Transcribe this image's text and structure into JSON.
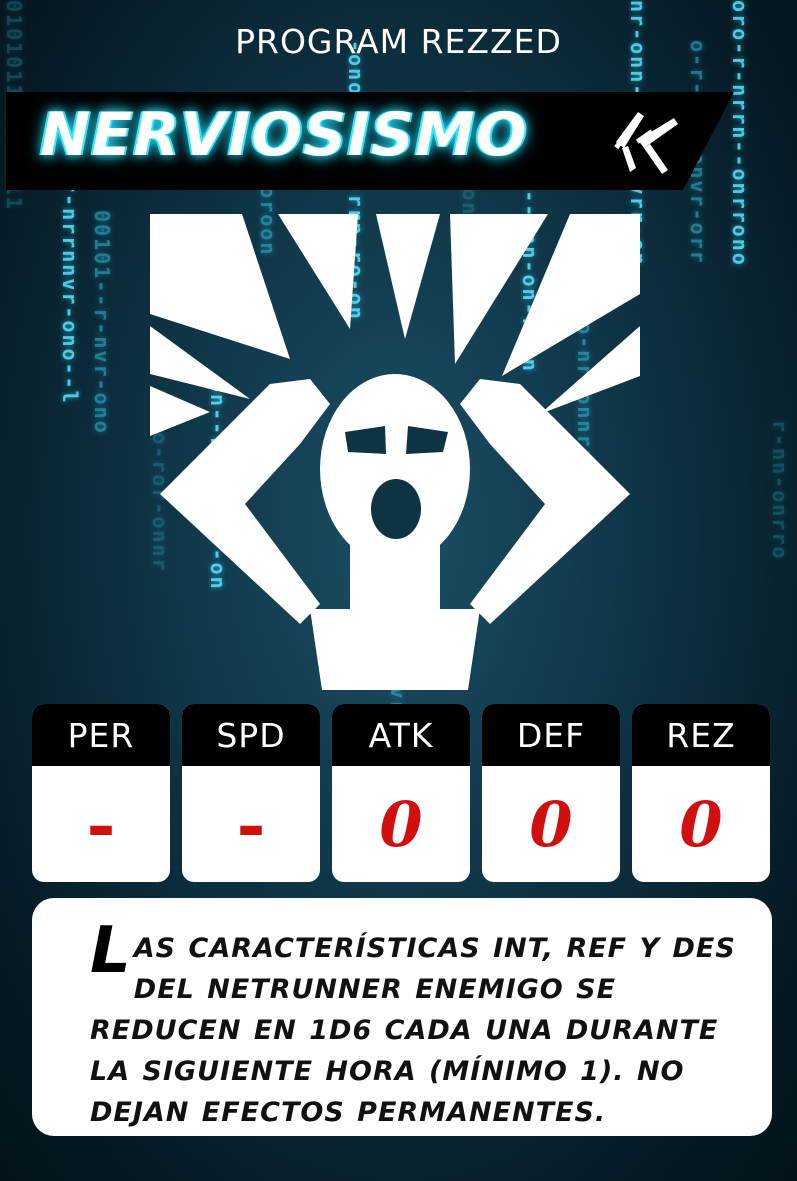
{
  "card": {
    "header": "PROGRAM REZZED",
    "title": "NERVIOSISMO",
    "type_icon": "crossed-knives-icon",
    "art_icon": "screaming-person-icon",
    "stats": [
      {
        "label": "PER",
        "value": "-"
      },
      {
        "label": "SPD",
        "value": "-"
      },
      {
        "label": "ATK",
        "value": "0"
      },
      {
        "label": "DEF",
        "value": "0"
      },
      {
        "label": "REZ",
        "value": "0"
      }
    ],
    "description_dropcap": "L",
    "description": "as características INT, REF y DES del netrunner enemigo se reducen en 1D6 cada una durante la siguiente hora (mínimo 1). No dejan efectos permanentes."
  },
  "colors": {
    "background": "#0e3345",
    "code_rain": "#3ad0ee",
    "title_glow": "#2ce8ff",
    "stat_value": "#d20f0f"
  }
}
